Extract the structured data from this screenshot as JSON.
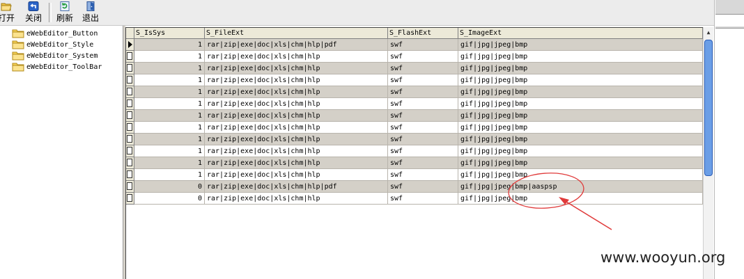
{
  "toolbar": {
    "buttons": [
      {
        "label": "打开",
        "icon": "open-folder-icon"
      },
      {
        "label": "关闭",
        "icon": "close-back-icon"
      },
      {
        "label": "刷新",
        "icon": "refresh-icon"
      },
      {
        "label": "退出",
        "icon": "exit-door-icon"
      }
    ]
  },
  "tree": {
    "items": [
      {
        "label": "eWebEditor_Button"
      },
      {
        "label": "eWebEditor_Style"
      },
      {
        "label": "eWebEditor_System"
      },
      {
        "label": "eWebEditor_ToolBar"
      }
    ]
  },
  "grid": {
    "columns": [
      "S_IsSys",
      "S_FileExt",
      "S_FlashExt",
      "S_ImageExt"
    ],
    "rows": [
      {
        "is_sys": "1",
        "file_ext": "rar|zip|exe|doc|xls|chm|hlp|pdf",
        "flash_ext": "swf",
        "image_ext": "gif|jpg|jpeg|bmp"
      },
      {
        "is_sys": "1",
        "file_ext": "rar|zip|exe|doc|xls|chm|hlp",
        "flash_ext": "swf",
        "image_ext": "gif|jpg|jpeg|bmp"
      },
      {
        "is_sys": "1",
        "file_ext": "rar|zip|exe|doc|xls|chm|hlp",
        "flash_ext": "swf",
        "image_ext": "gif|jpg|jpeg|bmp"
      },
      {
        "is_sys": "1",
        "file_ext": "rar|zip|exe|doc|xls|chm|hlp",
        "flash_ext": "swf",
        "image_ext": "gif|jpg|jpeg|bmp"
      },
      {
        "is_sys": "1",
        "file_ext": "rar|zip|exe|doc|xls|chm|hlp",
        "flash_ext": "swf",
        "image_ext": "gif|jpg|jpeg|bmp"
      },
      {
        "is_sys": "1",
        "file_ext": "rar|zip|exe|doc|xls|chm|hlp",
        "flash_ext": "swf",
        "image_ext": "gif|jpg|jpeg|bmp"
      },
      {
        "is_sys": "1",
        "file_ext": "rar|zip|exe|doc|xls|chm|hlp",
        "flash_ext": "swf",
        "image_ext": "gif|jpg|jpeg|bmp"
      },
      {
        "is_sys": "1",
        "file_ext": "rar|zip|exe|doc|xls|chm|hlp",
        "flash_ext": "swf",
        "image_ext": "gif|jpg|jpeg|bmp"
      },
      {
        "is_sys": "1",
        "file_ext": "rar|zip|exe|doc|xls|chm|hlp",
        "flash_ext": "swf",
        "image_ext": "gif|jpg|jpeg|bmp"
      },
      {
        "is_sys": "1",
        "file_ext": "rar|zip|exe|doc|xls|chm|hlp",
        "flash_ext": "swf",
        "image_ext": "gif|jpg|jpeg|bmp"
      },
      {
        "is_sys": "1",
        "file_ext": "rar|zip|exe|doc|xls|chm|hlp",
        "flash_ext": "swf",
        "image_ext": "gif|jpg|jpeg|bmp"
      },
      {
        "is_sys": "1",
        "file_ext": "rar|zip|exe|doc|xls|chm|hlp",
        "flash_ext": "swf",
        "image_ext": "gif|jpg|jpeg|bmp"
      },
      {
        "is_sys": "0",
        "file_ext": "rar|zip|exe|doc|xls|chm|hlp|pdf",
        "flash_ext": "swf",
        "image_ext": "gif|jpg|jpeg|bmp|aaspsp"
      },
      {
        "is_sys": "0",
        "file_ext": "rar|zip|exe|doc|xls|chm|hlp",
        "flash_ext": "swf",
        "image_ext": "gif|jpg|jpeg|bmp"
      }
    ]
  },
  "watermark": "www.wooyun.org",
  "colors": {
    "row_alt": "#d4d0c8",
    "annotation": "#e03a3a",
    "scroll_thumb": "#6b9ee6"
  }
}
